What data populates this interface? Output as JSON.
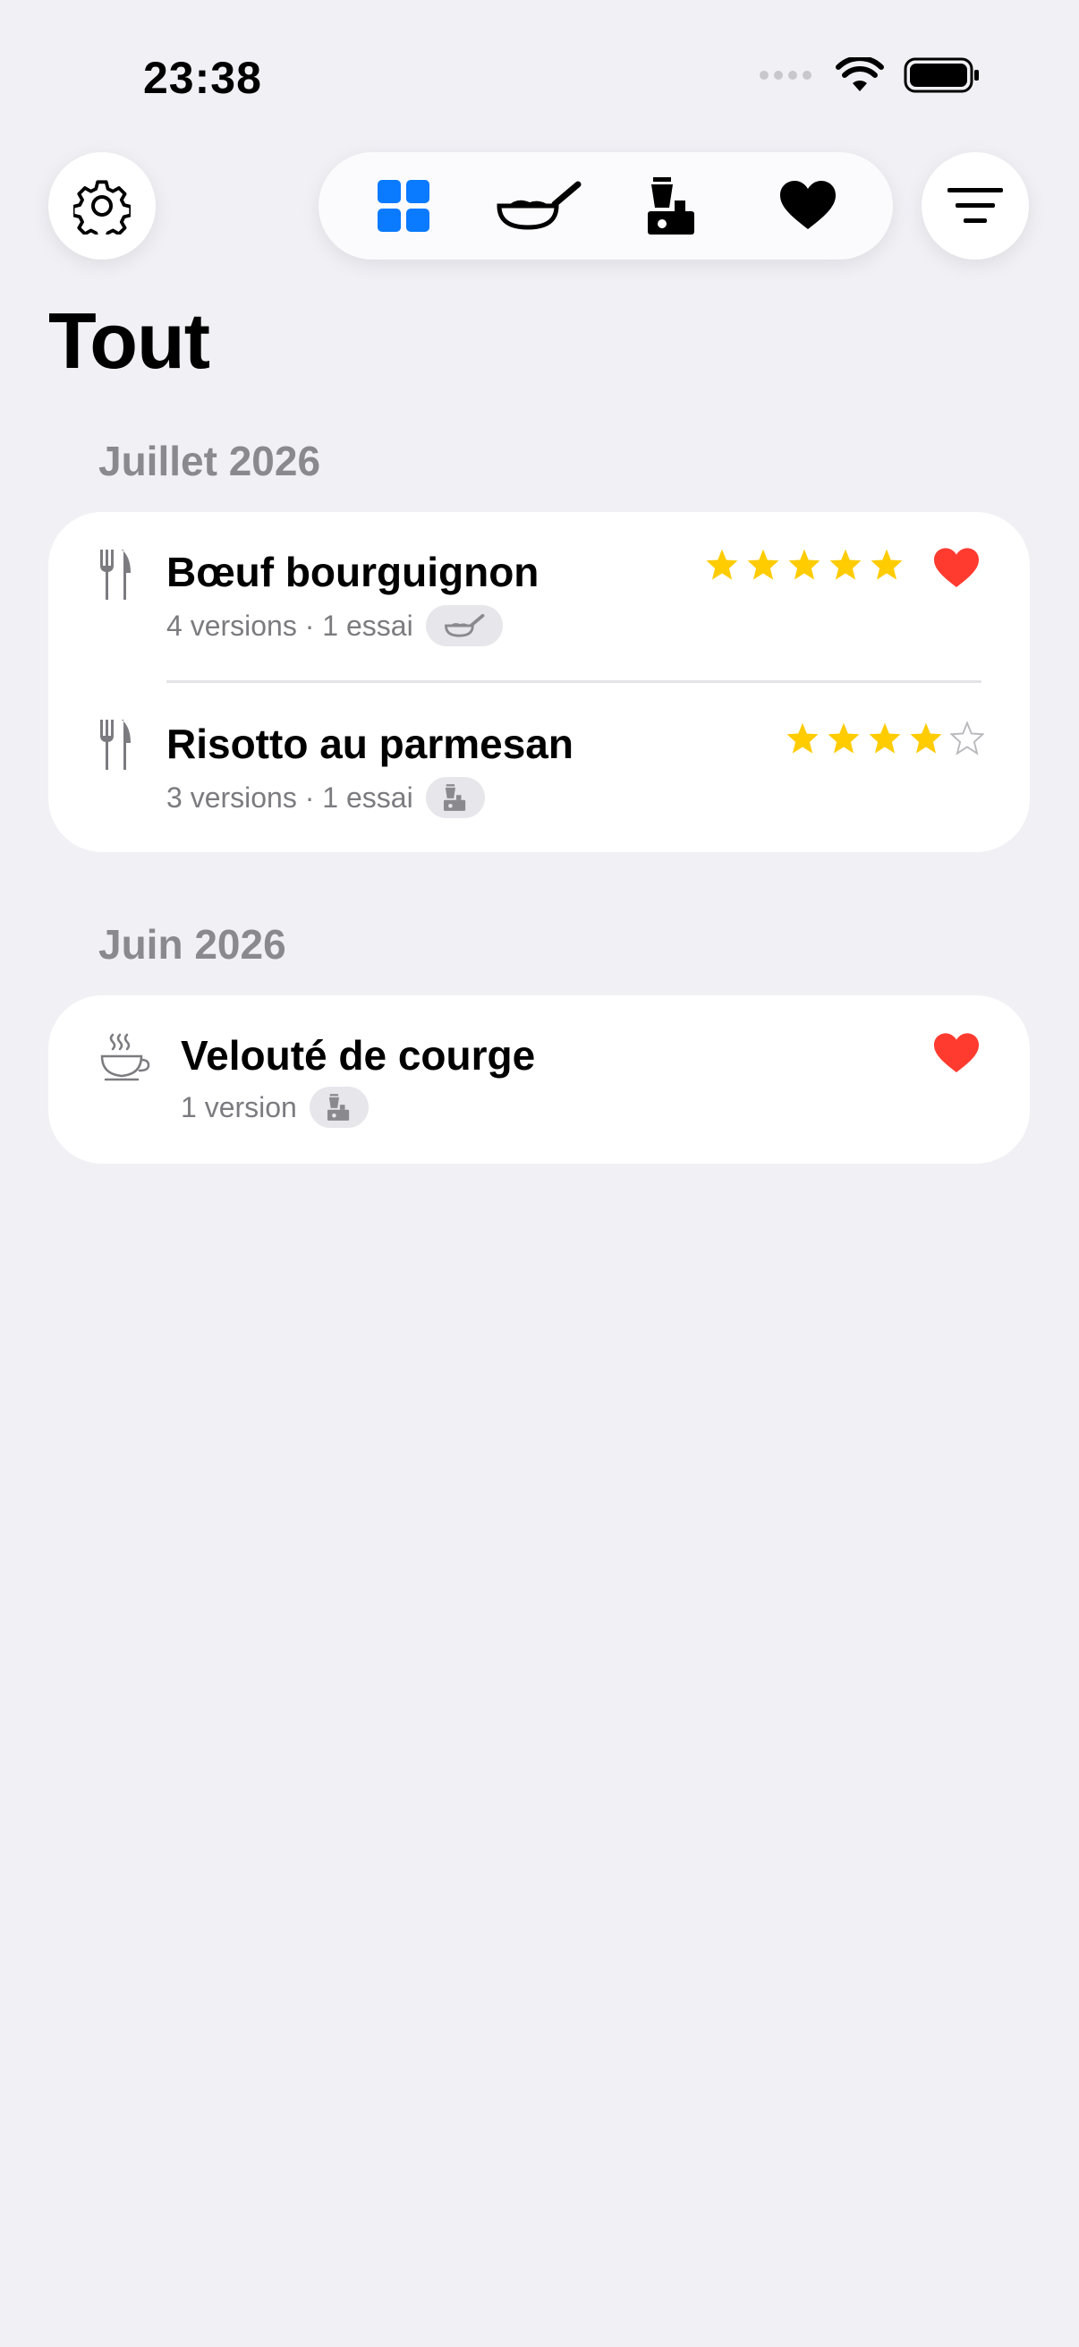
{
  "status_bar": {
    "time": "23:38",
    "icons": [
      "cellular-icon",
      "wifi-icon",
      "battery-icon"
    ]
  },
  "toolbar": {
    "settings_icon": "gear-icon",
    "filter_icon": "filter-lines-icon",
    "segments": [
      {
        "name": "grid-icon",
        "selected": true,
        "color": "#0a7aff"
      },
      {
        "name": "pan-icon",
        "selected": false
      },
      {
        "name": "blender-icon",
        "selected": false
      },
      {
        "name": "heart-icon",
        "selected": false
      }
    ]
  },
  "page_title": "Tout",
  "sections": [
    {
      "header": "Juillet 2026",
      "items": [
        {
          "icon": "fork-knife-icon",
          "title": "Bœuf bourguignon",
          "subtitle": "4 versions · 1 essai",
          "chip_icon": "pan-icon",
          "rating": 5,
          "favorite": true
        },
        {
          "icon": "fork-knife-icon",
          "title": "Risotto au parmesan",
          "subtitle": "3 versions · 1 essai",
          "chip_icon": "blender-icon",
          "rating": 4,
          "favorite": false
        }
      ]
    },
    {
      "header": "Juin 2026",
      "items": [
        {
          "icon": "soup-cup-icon",
          "title": "Velouté de courge",
          "subtitle": "1 version",
          "chip_icon": "blender-icon",
          "rating": 0,
          "favorite": true
        }
      ]
    }
  ],
  "colors": {
    "accent": "#0a7aff",
    "star": "#ffcc00",
    "heart": "#ff3b30",
    "background": "#f0f0f5"
  }
}
